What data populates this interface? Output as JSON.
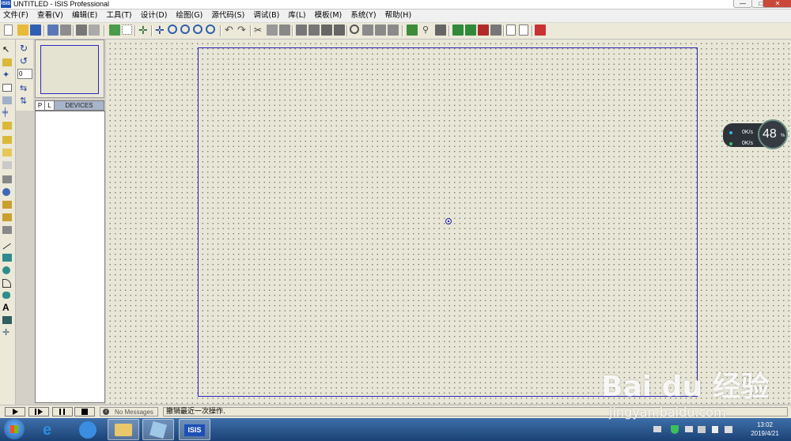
{
  "window": {
    "title": "UNTITLED - ISIS Professional",
    "app_icon_text": "ISIS",
    "minimize": "—",
    "maximize": "□",
    "close": "✕"
  },
  "menu": [
    "文件(F)",
    "查看(V)",
    "编辑(E)",
    "工具(T)",
    "设计(D)",
    "绘图(G)",
    "源代码(S)",
    "调试(B)",
    "库(L)",
    "模板(M)",
    "系统(Y)",
    "帮助(H)"
  ],
  "rotation": {
    "value": "0"
  },
  "device_panel": {
    "p_button": "P",
    "l_button": "L",
    "header": "DEVICES"
  },
  "net_widget": {
    "upload": "0K/s",
    "download": "0K/s",
    "percent": "48",
    "percent_unit": "%"
  },
  "status": {
    "messages": "No Messages",
    "text": "撤销最近一次操作."
  },
  "taskbar": {
    "isis_label": "ISIS",
    "time": "13:02",
    "date": "2019/4/21"
  },
  "watermark": {
    "brand": "Bai du 经验",
    "url": "jingyan.baidu.com"
  }
}
